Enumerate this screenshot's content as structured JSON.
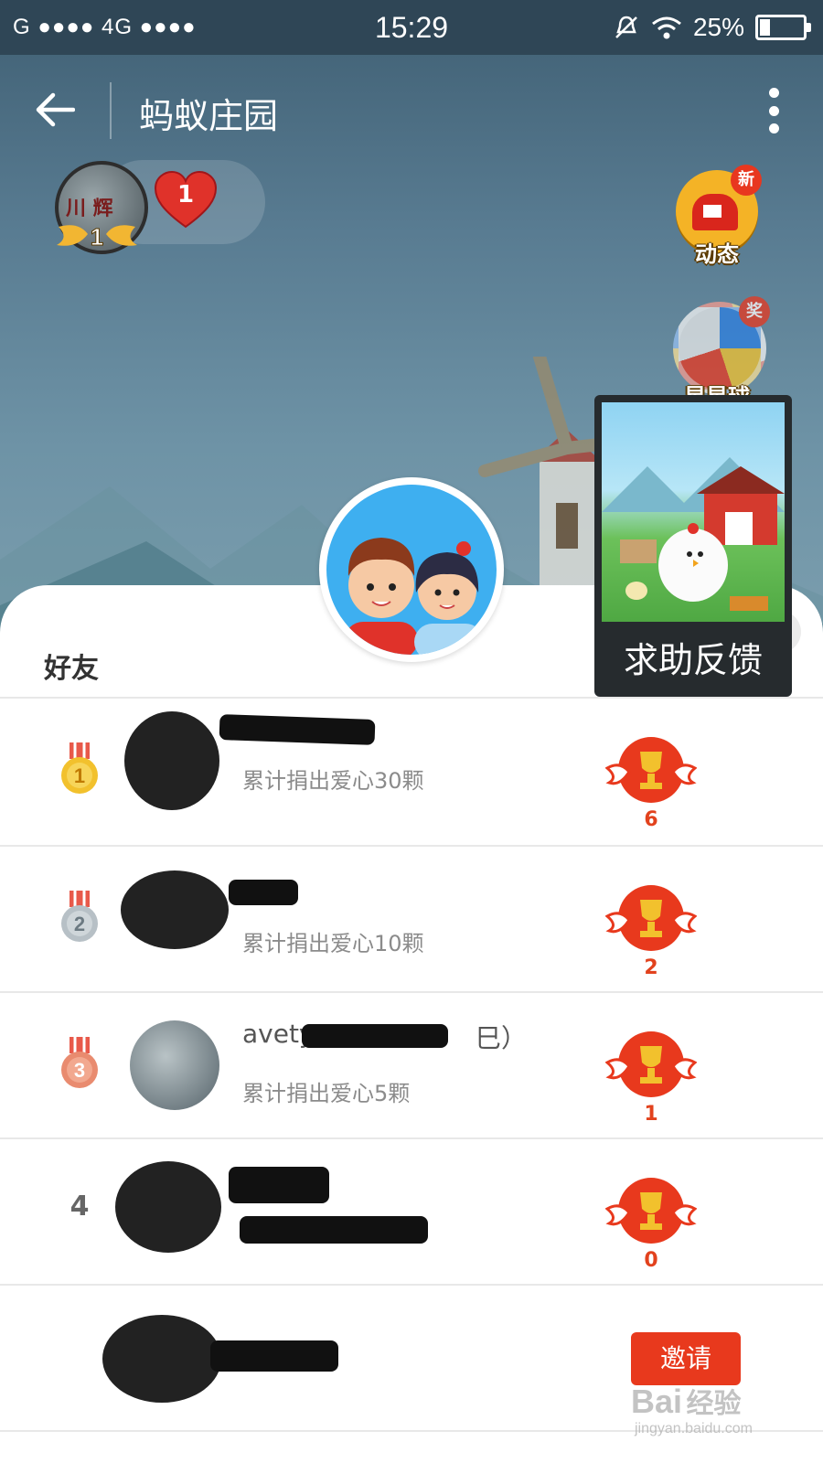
{
  "status_bar": {
    "carrier": "G ●●●● 4G ●●●●",
    "time": "15:29",
    "battery_percent": "25%",
    "battery_level": 0.25
  },
  "header": {
    "title": "蚂蚁庄园"
  },
  "user": {
    "level": "1",
    "hearts": "1"
  },
  "side_buttons": [
    {
      "label": "动态",
      "badge": "新"
    },
    {
      "label": "星星球",
      "badge": "奖"
    }
  ],
  "help_popup": {
    "label": "求助反馈"
  },
  "section": {
    "title": "好友"
  },
  "friends": [
    {
      "rank": "1",
      "subtitle": "累计捐出爱心30颗",
      "trophies": "6"
    },
    {
      "rank": "2",
      "subtitle": "累计捐出爱心10颗",
      "trophies": "2"
    },
    {
      "rank": "3",
      "name_partial": "avety",
      "name_tail": "巳）",
      "subtitle": "累计捐出爱心5颗",
      "trophies": "1"
    },
    {
      "rank": "4",
      "subtitle": "",
      "trophies": "0"
    },
    {
      "rank": "",
      "subtitle": "",
      "action": "邀请"
    }
  ],
  "watermark": {
    "brand": "Bai",
    "brand_cn": "经验",
    "url": "jingyan.baidu.com"
  },
  "colors": {
    "accent_red": "#e8391d",
    "header_bg": "#2f4656",
    "rank_gold": "#f2c12d",
    "rank_silver": "#b7c0c6",
    "rank_bronze": "#e98b6f"
  }
}
